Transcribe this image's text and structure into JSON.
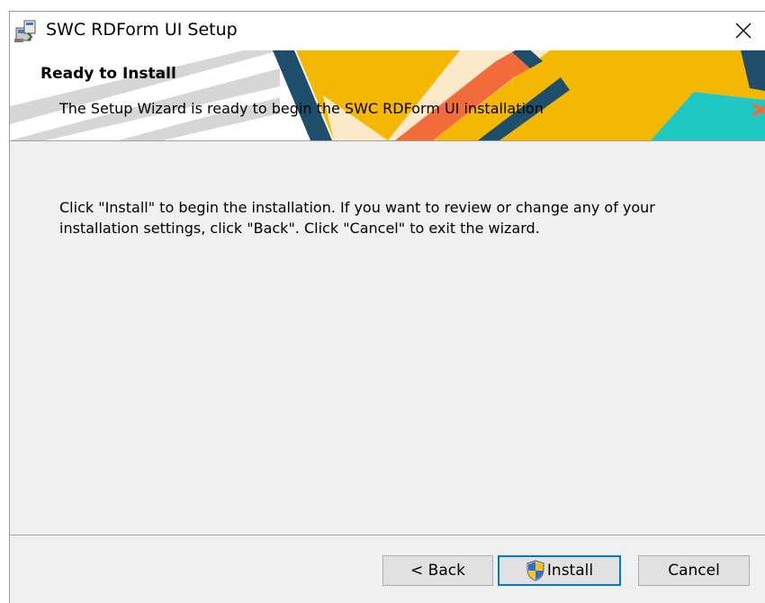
{
  "window": {
    "title": "SWC RDForm UI Setup"
  },
  "header": {
    "title": "Ready to Install",
    "subtitle": "The Setup Wizard is ready to begin the SWC RDForm UI installation"
  },
  "body": {
    "line1": "Click \"Install\" to begin the installation.  If you want to review or change any of your",
    "line2": "installation settings, click \"Back\".  Click \"Cancel\" to exit the wizard."
  },
  "buttons": {
    "back": "< Back",
    "install": "Install",
    "cancel": "Cancel"
  },
  "icons": {
    "app": "installer-package-icon",
    "close": "close-icon",
    "install": "uac-shield-icon"
  },
  "colors": {
    "accent": "#0078d7",
    "banner_yellow": "#f5b800",
    "banner_orange": "#f26b3a",
    "banner_teal": "#1ec9c3",
    "banner_navy": "#1d4e6b"
  }
}
